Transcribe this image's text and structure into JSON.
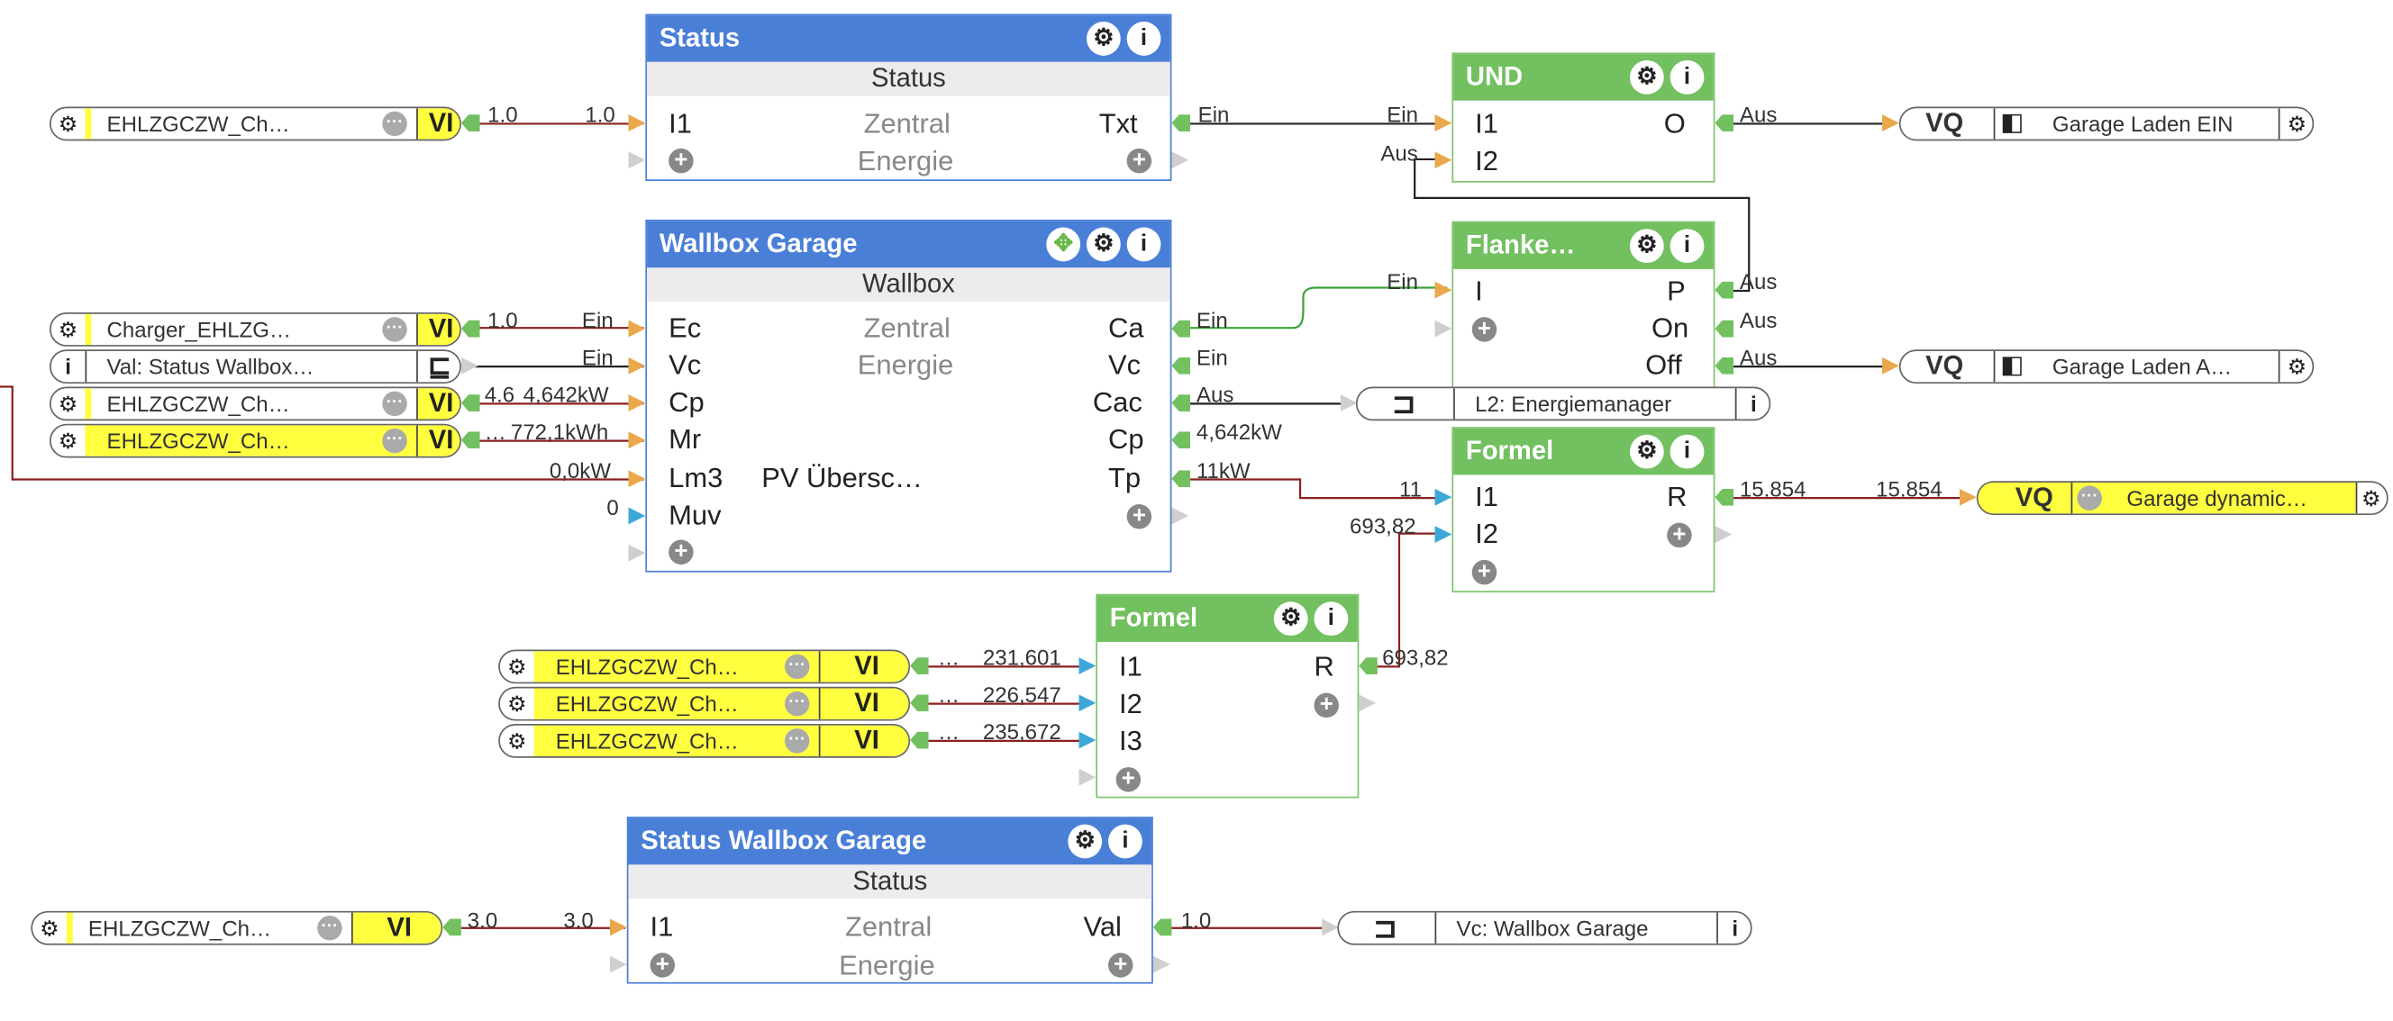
{
  "blocks": {
    "status": {
      "title": "Status",
      "subtitle": "Status",
      "left_port": "I1",
      "center1": "Zentral",
      "center2": "Energie",
      "right_port": "Txt"
    },
    "wallbox": {
      "title": "Wallbox Garage",
      "subtitle": "Wallbox",
      "center1": "Zentral",
      "center2": "Energie",
      "lm3_desc": "PV Übersc…",
      "inputs": [
        "Ec",
        "Vc",
        "Cp",
        "Mr",
        "Lm3",
        "Muv"
      ],
      "outputs": [
        "Ca",
        "Vc",
        "Cac",
        "Cp",
        "Tp"
      ]
    },
    "und": {
      "title": "UND",
      "inputs": [
        "I1",
        "I2"
      ],
      "output": "O"
    },
    "flanke": {
      "title": "Flanke…",
      "input": "I",
      "outputs": [
        "P",
        "On",
        "Off"
      ]
    },
    "formel1": {
      "title": "Formel",
      "inputs": [
        "I1",
        "I2"
      ],
      "output": "R"
    },
    "formel2": {
      "title": "Formel",
      "inputs": [
        "I1",
        "I2",
        "I3"
      ],
      "output": "R"
    },
    "status_wallbox": {
      "title": "Status Wallbox Garage",
      "subtitle": "Status",
      "left_port": "I1",
      "center1": "Zentral",
      "center2": "Energie",
      "right_port": "Val"
    }
  },
  "nodes": {
    "in1": {
      "label": "EHLZGCZW_Ch…",
      "tag": "VI"
    },
    "in2": {
      "label": "Charger_EHLZG…",
      "tag": "VI"
    },
    "in3": {
      "label": "Val: Status Wallbox…"
    },
    "in4": {
      "label": "EHLZGCZW_Ch…",
      "tag": "VI"
    },
    "in5": {
      "label": "EHLZGCZW_Ch…",
      "tag": "VI"
    },
    "in6": {
      "label": "EHLZGCZW_Ch…",
      "tag": "VI"
    },
    "in7": {
      "label": "EHLZGCZW_Ch…",
      "tag": "VI"
    },
    "in8": {
      "label": "EHLZGCZW_Ch…",
      "tag": "VI"
    },
    "in9": {
      "label": "EHLZGCZW_Ch…",
      "tag": "VI"
    },
    "out1": {
      "tag": "VQ",
      "label": "Garage Laden EIN"
    },
    "out2": {
      "tag": "VQ",
      "label": "Garage Laden A…"
    },
    "out3": {
      "label": "L2: Energiemanager"
    },
    "out4": {
      "tag": "VQ",
      "label": "Garage dynamic…"
    },
    "out5": {
      "label": "Vc: Wallbox Garage"
    }
  },
  "wire_labels": {
    "w1a": "1.0",
    "w1b": "1.0",
    "w2a": "Ein",
    "w2b": "Ein",
    "w3": "Aus",
    "w4": "Aus",
    "w5a": "1.0",
    "w5b": "Ein",
    "w6": "Ein",
    "w7a": "4.6",
    "w7b": "4,642kW",
    "w8a": "…",
    "w8b": "772,1kWh",
    "w9": "0,0kW",
    "w10": "0",
    "w11": "Ein",
    "w11b": "Ein",
    "w12": "Ein",
    "w13": "Aus",
    "w14": "4,642kW",
    "w15a": "11kW",
    "w15b": "11",
    "w16": "693,82",
    "w17a": "Aus",
    "w17b": "Aus",
    "w17c": "Aus",
    "w18a": "15.854",
    "w18b": "15.854",
    "w19a": "…",
    "w19b": "231,601",
    "w20a": "…",
    "w20b": "226,547",
    "w21a": "…",
    "w21b": "235,672",
    "w22": "693,82",
    "w23a": "3.0",
    "w23b": "3.0",
    "w24": "1.0"
  },
  "colors": {
    "block_blue": "#4a7fd8",
    "block_green": "#72c05f",
    "wire_red": "#8b2020",
    "wire_green": "#3aa53a",
    "wire_black": "#222222",
    "input_yellow": "#ffff40"
  }
}
